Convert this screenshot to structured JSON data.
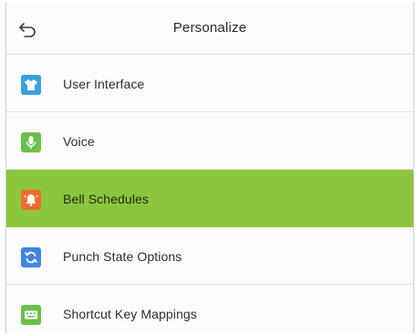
{
  "header": {
    "title": "Personalize"
  },
  "menu": {
    "items": [
      {
        "label": "User Interface",
        "icon": "shirt-icon",
        "icon_color": "#3aa0e0",
        "selected": false
      },
      {
        "label": "Voice",
        "icon": "microphone-icon",
        "icon_color": "#6cbf4a",
        "selected": false
      },
      {
        "label": "Bell Schedules",
        "icon": "bell-icon",
        "icon_color": "#f26a2e",
        "selected": true
      },
      {
        "label": "Punch State Options",
        "icon": "refresh-icon",
        "icon_color": "#3f86e0",
        "selected": false
      },
      {
        "label": "Shortcut Key Mappings",
        "icon": "keyboard-icon",
        "icon_color": "#6cbf4a",
        "selected": false
      }
    ]
  },
  "colors": {
    "selected_row": "#8cc63e",
    "divider": "#e2e2e2",
    "text": "#2e2e2e"
  }
}
